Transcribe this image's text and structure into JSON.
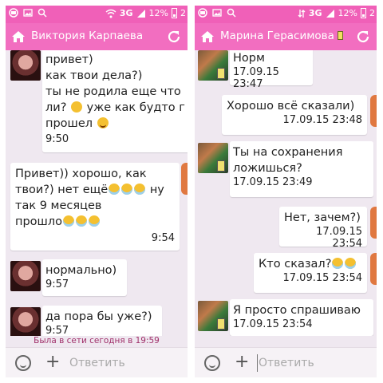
{
  "left": {
    "status": {
      "net": "3G",
      "battery": "12%",
      "extra": "2"
    },
    "title": "Виктория Карпаева",
    "messages": [
      {
        "from": "them",
        "text": "привет)\nкак твои дела?)\nты не родила еще что\nли?",
        "text2": " уже как будто г\nпрошел",
        "time": "9:50"
      },
      {
        "from": "me",
        "text": "Привет)) хорошо, как\nтвои?) нет ещё",
        "text2": " ну\nтак 9 месяцев\nпрошло",
        "time": "9:54"
      },
      {
        "from": "them",
        "text": "нормально)",
        "time": "9:57"
      },
      {
        "from": "them",
        "text": "да пора бы уже?)",
        "time": "9:57"
      }
    ],
    "presence": "Была в сети сегодня в 19:59",
    "input_placeholder": "Ответить"
  },
  "right": {
    "status": {
      "net": "3G",
      "battery": "12%",
      "extra": "2"
    },
    "title": "Марина Герасимова",
    "messages": [
      {
        "from": "them",
        "text": "Норм",
        "time": "17.09.15 23:47"
      },
      {
        "from": "me",
        "text": "Хорошо всё сказали)",
        "time": "17.09.15 23:48"
      },
      {
        "from": "them",
        "text": "Ты на сохранения\nложишься?",
        "time": "17.09.15 23:49"
      },
      {
        "from": "me",
        "text": "Нет, зачем?)",
        "time": "17.09.15 23:54"
      },
      {
        "from": "me",
        "text": "Кто сказал?",
        "time": "17.09.15 23:54"
      },
      {
        "from": "them",
        "text": "Я просто спрашиваю",
        "time": "17.09.15 23:54"
      }
    ],
    "input_placeholder": "Ответить"
  },
  "colors": {
    "accent": "#f26ec0",
    "statusbar": "#f060b8",
    "chat_bg": "#efe8f0",
    "presence_text": "#a0306a"
  },
  "icons": [
    "home-icon",
    "refresh-icon",
    "smiley-icon",
    "plus-icon",
    "wifi-icon",
    "signal-icon",
    "battery-icon",
    "search-icon"
  ]
}
